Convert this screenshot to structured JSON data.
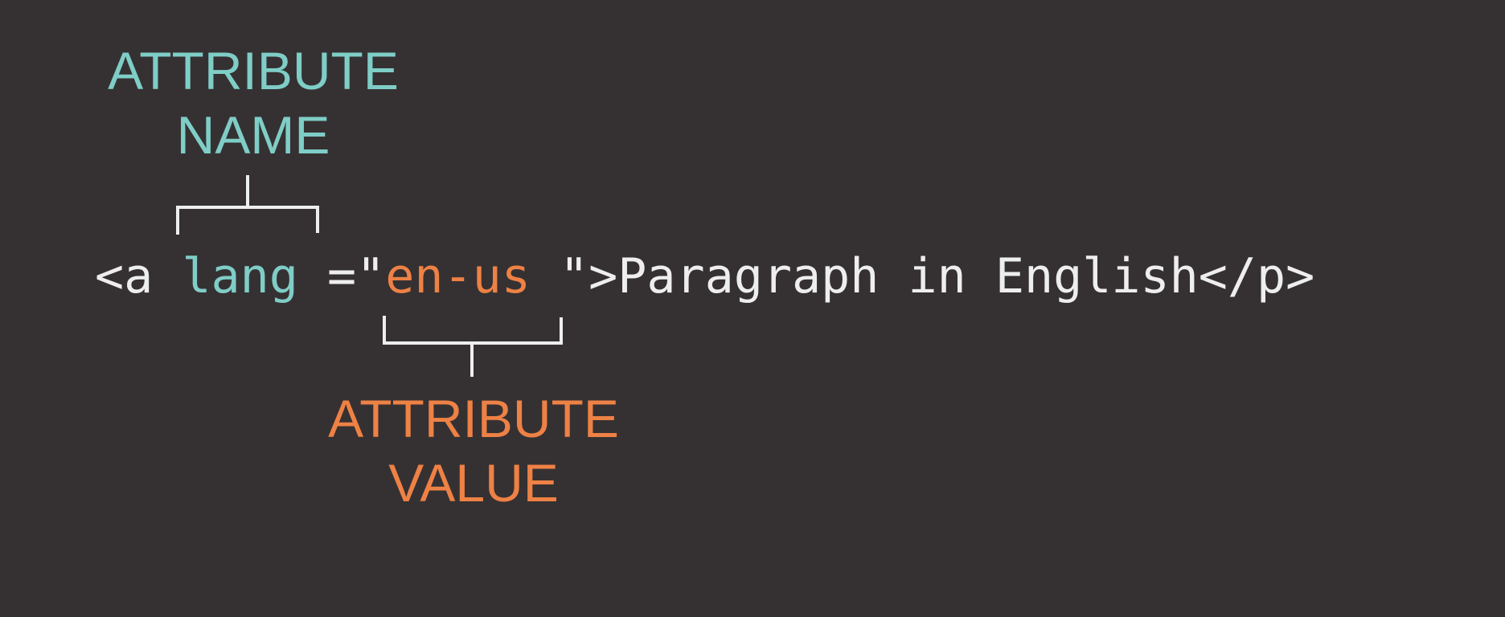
{
  "labels": {
    "attribute_name": {
      "line1": "ATTRIBUTE",
      "line2": "NAME"
    },
    "attribute_value": {
      "line1": "ATTRIBUTE",
      "line2": "VALUE"
    }
  },
  "code": {
    "tag_open": "<a ",
    "attribute_name": "lang",
    "equals_quote": " =\"",
    "attribute_value": "en-us",
    "close_quote_bracket": " \">",
    "text_content": "Paragraph in English",
    "tag_close": "</p>"
  },
  "colors": {
    "background": "#353132",
    "name_accent": "#7fcdc7",
    "value_accent": "#ee8145",
    "code_text": "#eeeeee",
    "bracket_stroke": "#eeeeee"
  }
}
